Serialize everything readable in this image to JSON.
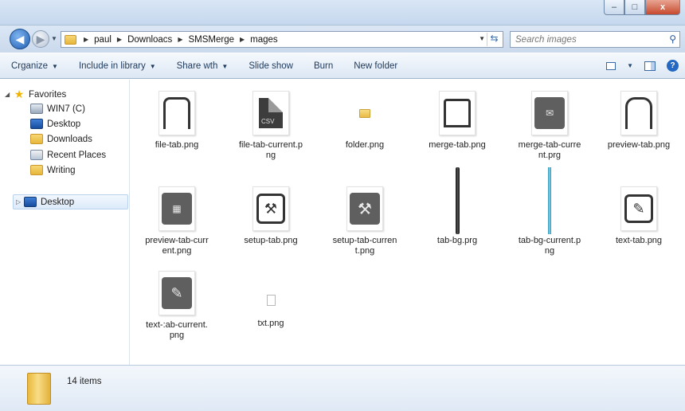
{
  "window": {
    "minimize": "–",
    "maximize": "□",
    "close": "x"
  },
  "nav": {
    "back": "◀",
    "forward": "▶"
  },
  "address": {
    "crumbs": [
      "paul",
      "Downloacs",
      "SMSMerge",
      "mages"
    ]
  },
  "search": {
    "placeholder": "Search images"
  },
  "toolbar": {
    "organize": "Crganize",
    "include_in_library": "Include in library",
    "share_with": "Share wth",
    "slide_show": "Slide show",
    "burn": "Burn",
    "new_folder": "New folder"
  },
  "sidebar": {
    "favorites": "Favorites",
    "items": [
      {
        "label": "WIN7 (C)",
        "icon": "drive-icon"
      },
      {
        "label": "Desktop",
        "icon": "desktop-icon"
      },
      {
        "label": "Downloads",
        "icon": "downloads-folder-icon"
      },
      {
        "label": "Recent Places",
        "icon": "recent-places-icon"
      },
      {
        "label": "Writing",
        "icon": "folder-icon"
      }
    ],
    "desktop_root": "Desktop"
  },
  "files": [
    {
      "name": "file-tab.png",
      "thumb": "tab-outline"
    },
    {
      "name": "file-tab-current.png",
      "thumb": "csv-document"
    },
    {
      "name": "folder.png",
      "thumb": "small-folder"
    },
    {
      "name": "merge-tab.png",
      "thumb": "tab-outline"
    },
    {
      "name": "merge-tab-current.png",
      "thumb": "envelope-tile"
    },
    {
      "name": "preview-tab.png",
      "thumb": "tab-outline"
    },
    {
      "name": "preview-tab-current.png",
      "thumb": "grid-tile"
    },
    {
      "name": "setup-tab.png",
      "thumb": "tools-outline"
    },
    {
      "name": "setup-tab-current.png",
      "thumb": "tools-tile"
    },
    {
      "name": "tab-bg.prg",
      "thumb": "dark-strip"
    },
    {
      "name": "tab-bg-current.png",
      "thumb": "blue-strip"
    },
    {
      "name": "text-tab.png",
      "thumb": "pencil-outline"
    },
    {
      "name": "text-tab-current.png",
      "thumb": "pencil-tile"
    },
    {
      "name": "txt.png",
      "thumb": "small-document"
    }
  ],
  "file_labels": {
    "f0": [
      "file-tab.png"
    ],
    "f1": [
      "file-tab-current.p",
      "ng"
    ],
    "f2": [
      "folder.png"
    ],
    "f3": [
      "merge-tab.png"
    ],
    "f4": [
      "merge-tab-curre",
      "nt.prg"
    ],
    "f5": [
      "preview-tab.png"
    ],
    "f6": [
      "preview-tab-curr",
      "ent.png"
    ],
    "f7": [
      "setup-tab.png"
    ],
    "f8": [
      "setup-tab-curren",
      "t.png"
    ],
    "f9": [
      "tab-bg.prg"
    ],
    "f10": [
      "tab-bg-current.p",
      "ng"
    ],
    "f11": [
      "text-tab.png"
    ],
    "f12": [
      "text-:ab-current.",
      "png"
    ],
    "f13": [
      "txt.png"
    ]
  },
  "details": {
    "count": "14 items"
  }
}
